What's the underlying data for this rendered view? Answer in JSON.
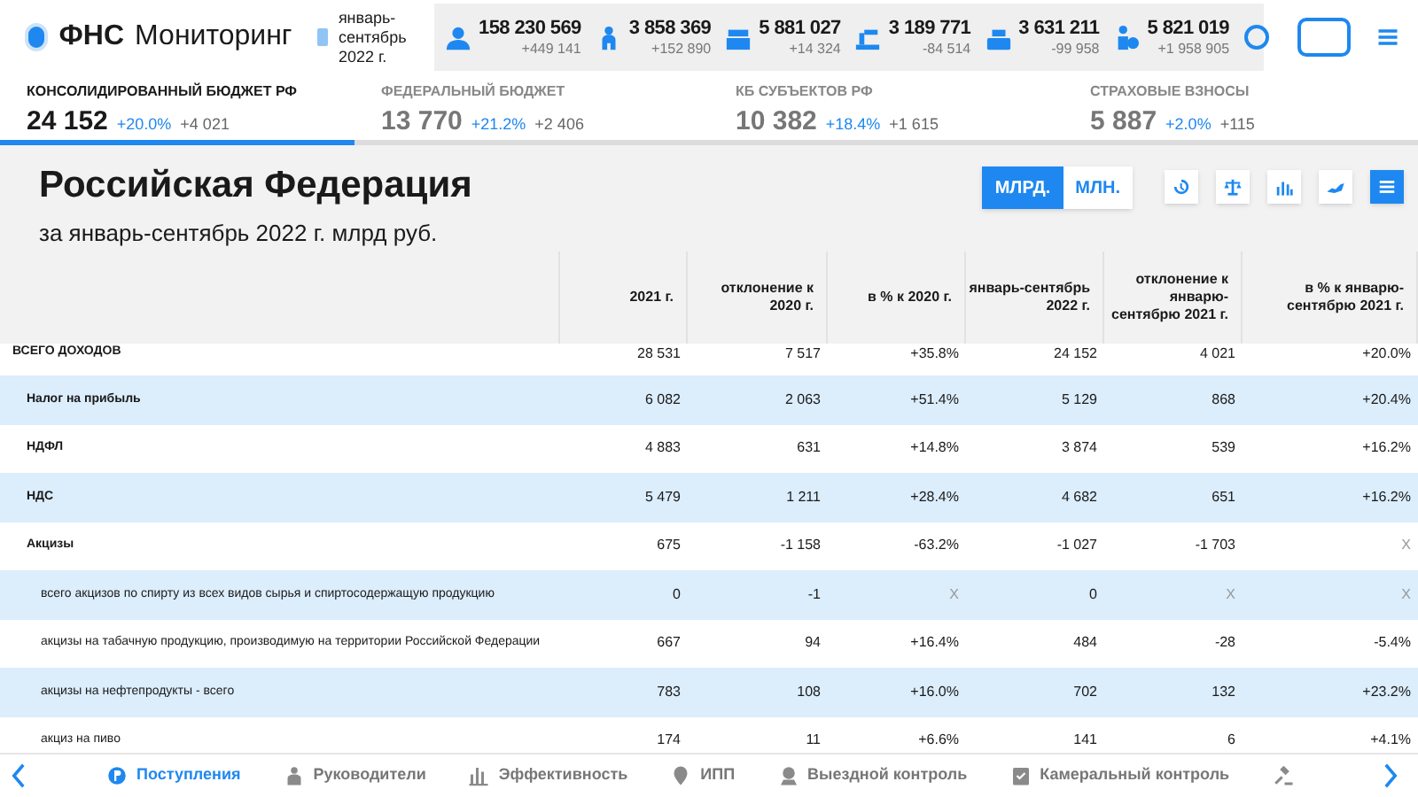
{
  "header": {
    "brand": "ФНС",
    "app": "Мониторинг",
    "period": "январь-сентябрь 2022 г.",
    "stats": [
      {
        "kind": "person",
        "value": "158 230 569",
        "delta": "+449 141"
      },
      {
        "kind": "people",
        "value": "3 858 369",
        "delta": "+152 890"
      },
      {
        "kind": "company",
        "value": "5 881 027",
        "delta": "+14 324"
      },
      {
        "kind": "factory",
        "value": "3 189 771",
        "delta": "-84 514"
      },
      {
        "kind": "register",
        "value": "3 631 211",
        "delta": "-99 958"
      },
      {
        "kind": "entrepreneur",
        "value": "5 821 019",
        "delta": "+1 958 905"
      }
    ]
  },
  "budgets": [
    {
      "label": "КОНСОЛИДИРОВАННЫЙ БЮДЖЕТ РФ",
      "value": "24 152",
      "percent": "+20.0%",
      "delta": "+4 021",
      "selected": true
    },
    {
      "label": "ФЕДЕРАЛЬНЫЙ БЮДЖЕТ",
      "value": "13 770",
      "percent": "+21.2%",
      "delta": "+2 406",
      "selected": false
    },
    {
      "label": "КБ СУБЪЕКТОВ РФ",
      "value": "10 382",
      "percent": "+18.4%",
      "delta": "+1 615",
      "selected": false
    },
    {
      "label": "СТРАХОВЫЕ ВЗНОСЫ",
      "value": "5 887",
      "percent": "+2.0%",
      "delta": "+115",
      "selected": false
    }
  ],
  "title": "Российская Федерация",
  "subtitle": "за январь-сентябрь 2022 г. млрд руб.",
  "units": [
    {
      "label": "МЛРД.",
      "selected": true
    },
    {
      "label": "МЛН.",
      "selected": false
    }
  ],
  "views": [
    {
      "kind": "history",
      "selected": false
    },
    {
      "kind": "scales",
      "selected": false
    },
    {
      "kind": "bars",
      "selected": false
    },
    {
      "kind": "map",
      "selected": false
    },
    {
      "kind": "table",
      "selected": true
    }
  ],
  "table": {
    "columns": [
      "2021 г.",
      "отклонение к 2020 г.",
      "в % к 2020 г.",
      "январь-сентябрь 2022 г.",
      "отклонение к январю-сентябрю 2021 г.",
      "в % к январю-сентябрю 2021 г."
    ],
    "rows": [
      {
        "label": "ВСЕГО ДОХОДОВ",
        "cells": [
          "28 531",
          "7 517",
          "+35.8%",
          "24 152",
          "4 021",
          "+20.0%"
        ],
        "children": [
          {
            "label": "Налог на прибыль",
            "cells": [
              "6 082",
              "2 063",
              "+51.4%",
              "5 129",
              "868",
              "+20.4%"
            ]
          },
          {
            "label": "НДФЛ",
            "cells": [
              "4 883",
              "631",
              "+14.8%",
              "3 874",
              "539",
              "+16.2%"
            ]
          },
          {
            "label": "НДС",
            "cells": [
              "5 479",
              "1 211",
              "+28.4%",
              "4 682",
              "651",
              "+16.2%"
            ]
          },
          {
            "label": "Акцизы",
            "cells": [
              "675",
              "-1 158",
              "-63.2%",
              "-1 027",
              "-1 703",
              "X"
            ],
            "children": [
              {
                "label": "всего акцизов по спирту из всех видов сырья и спиртосодержащую продукцию",
                "cells": [
                  "0",
                  "-1",
                  "X",
                  "0",
                  "X",
                  "X"
                ]
              },
              {
                "label": "акцизы на табачную продукцию, производимую на территории Российской Федерации",
                "cells": [
                  "667",
                  "94",
                  "+16.4%",
                  "484",
                  "-28",
                  "-5.4%"
                ]
              },
              {
                "label": "акцизы на нефтепродукты - всего",
                "cells": [
                  "783",
                  "108",
                  "+16.0%",
                  "702",
                  "132",
                  "+23.2%"
                ]
              },
              {
                "label": "акциз на пиво",
                "cells": [
                  "174",
                  "11",
                  "+6.6%",
                  "141",
                  "6",
                  "+4.1%"
                ]
              }
            ]
          }
        ]
      }
    ]
  },
  "nav": [
    {
      "kind": "receipts",
      "label": "Поступления",
      "selected": true
    },
    {
      "kind": "managers",
      "label": "Руководители",
      "selected": false
    },
    {
      "kind": "efficiency",
      "label": "Эффективность",
      "selected": false
    },
    {
      "kind": "pin",
      "label": "ИПП",
      "selected": false
    },
    {
      "kind": "field",
      "label": "Выездной контроль",
      "selected": false
    },
    {
      "kind": "desk",
      "label": "Камеральный контроль",
      "selected": false
    },
    {
      "kind": "gavel",
      "selected": false
    }
  ]
}
